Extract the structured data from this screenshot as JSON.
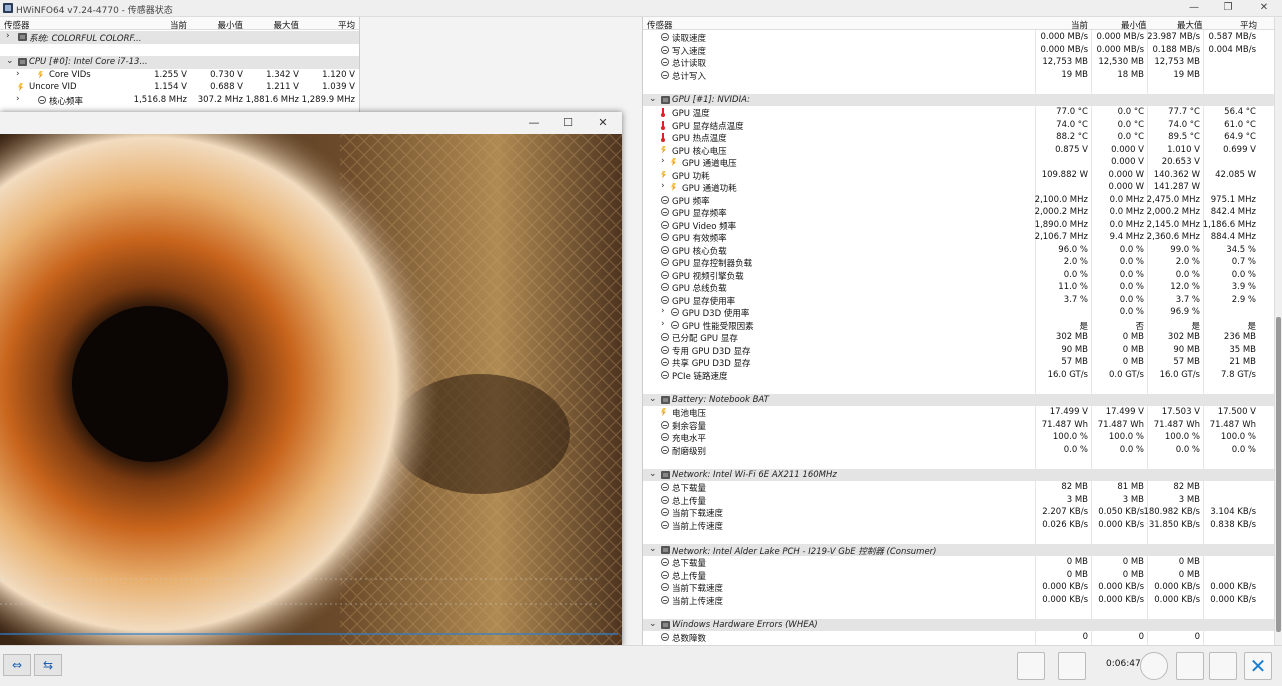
{
  "window": {
    "title": "HWiNFO64 v7.24-4770 - 传感器状态"
  },
  "columns": {
    "sensor": "传感器",
    "current": "当前",
    "min": "最小值",
    "max": "最大值",
    "avg": "平均"
  },
  "left_rows": [
    {
      "type": "group",
      "chev": "›",
      "label": "系统: COLORFUL COLORF...",
      "current": "",
      "min": "",
      "max": "",
      "avg": ""
    },
    {
      "type": "spacer"
    },
    {
      "type": "group",
      "chev": "⌄",
      "label": "CPU [#0]: Intel Core i7-13...",
      "current": "",
      "min": "",
      "max": "",
      "avg": ""
    },
    {
      "type": "item",
      "icon": "bolt",
      "chev": "›",
      "indent": 1,
      "label": "Core VIDs",
      "current": "1.255 V",
      "min": "0.730 V",
      "max": "1.342 V",
      "avg": "1.120 V"
    },
    {
      "type": "item",
      "icon": "bolt",
      "indent": 0,
      "label": "Uncore VID",
      "current": "1.154 V",
      "min": "0.688 V",
      "max": "1.211 V",
      "avg": "1.039 V"
    },
    {
      "type": "item",
      "icon": "clock",
      "chev": "›",
      "indent": 1,
      "label": "核心频率",
      "current": "1,516.8 MHz",
      "min": "307.2 MHz",
      "max": "1,881.6 MHz",
      "avg": "1,289.9 MHz"
    }
  ],
  "right_rows": [
    {
      "type": "item",
      "icon": "clock",
      "label": "读取速度",
      "current": "0.000 MB/s",
      "min": "0.000 MB/s",
      "max": "23.987 MB/s",
      "avg": "0.587 MB/s"
    },
    {
      "type": "item",
      "icon": "clock",
      "label": "写入速度",
      "current": "0.000 MB/s",
      "min": "0.000 MB/s",
      "max": "0.188 MB/s",
      "avg": "0.004 MB/s"
    },
    {
      "type": "item",
      "icon": "clock",
      "label": "总计读取",
      "current": "12,753 MB",
      "min": "12,530 MB",
      "max": "12,753 MB",
      "avg": ""
    },
    {
      "type": "item",
      "icon": "clock",
      "label": "总计写入",
      "current": "19 MB",
      "min": "18 MB",
      "max": "19 MB",
      "avg": ""
    },
    {
      "type": "spacer"
    },
    {
      "type": "group",
      "label": "GPU [#1]: NVIDIA:"
    },
    {
      "type": "item",
      "icon": "therm",
      "label": "GPU 温度",
      "current": "77.0 °C",
      "min": "0.0 °C",
      "max": "77.7 °C",
      "avg": "56.4 °C"
    },
    {
      "type": "item",
      "icon": "therm",
      "label": "GPU 显存结点温度",
      "current": "74.0 °C",
      "min": "0.0 °C",
      "max": "74.0 °C",
      "avg": "61.0 °C"
    },
    {
      "type": "item",
      "icon": "therm",
      "label": "GPU 热点温度",
      "current": "88.2 °C",
      "min": "0.0 °C",
      "max": "89.5 °C",
      "avg": "64.9 °C"
    },
    {
      "type": "item",
      "icon": "bolt",
      "label": "GPU 核心电压",
      "current": "0.875 V",
      "min": "0.000 V",
      "max": "1.010 V",
      "avg": "0.699 V"
    },
    {
      "type": "item",
      "icon": "bolt",
      "chev": "›",
      "label": "GPU 通道电压",
      "current": "",
      "min": "0.000 V",
      "max": "20.653 V",
      "avg": ""
    },
    {
      "type": "item",
      "icon": "bolt",
      "label": "GPU 功耗",
      "current": "109.882 W",
      "min": "0.000 W",
      "max": "140.362 W",
      "avg": "42.085 W"
    },
    {
      "type": "item",
      "icon": "bolt",
      "chev": "›",
      "label": "GPU 通道功耗",
      "current": "",
      "min": "0.000 W",
      "max": "141.287 W",
      "avg": ""
    },
    {
      "type": "item",
      "icon": "clock",
      "label": "GPU 频率",
      "current": "2,100.0 MHz",
      "min": "0.0 MHz",
      "max": "2,475.0 MHz",
      "avg": "975.1 MHz"
    },
    {
      "type": "item",
      "icon": "clock",
      "label": "GPU 显存频率",
      "current": "2,000.2 MHz",
      "min": "0.0 MHz",
      "max": "2,000.2 MHz",
      "avg": "842.4 MHz"
    },
    {
      "type": "item",
      "icon": "clock",
      "label": "GPU Video 频率",
      "current": "1,890.0 MHz",
      "min": "0.0 MHz",
      "max": "2,145.0 MHz",
      "avg": "1,186.6 MHz"
    },
    {
      "type": "item",
      "icon": "clock",
      "label": "GPU 有效频率",
      "current": "2,106.7 MHz",
      "min": "9.4 MHz",
      "max": "2,360.6 MHz",
      "avg": "884.4 MHz"
    },
    {
      "type": "item",
      "icon": "clock",
      "label": "GPU 核心负载",
      "current": "96.0 %",
      "min": "0.0 %",
      "max": "99.0 %",
      "avg": "34.5 %"
    },
    {
      "type": "item",
      "icon": "clock",
      "label": "GPU 显存控制器负载",
      "current": "2.0 %",
      "min": "0.0 %",
      "max": "2.0 %",
      "avg": "0.7 %"
    },
    {
      "type": "item",
      "icon": "clock",
      "label": "GPU 视频引擎负载",
      "current": "0.0 %",
      "min": "0.0 %",
      "max": "0.0 %",
      "avg": "0.0 %"
    },
    {
      "type": "item",
      "icon": "clock",
      "label": "GPU 总线负载",
      "current": "11.0 %",
      "min": "0.0 %",
      "max": "12.0 %",
      "avg": "3.9 %"
    },
    {
      "type": "item",
      "icon": "clock",
      "label": "GPU 显存使用率",
      "current": "3.7 %",
      "min": "0.0 %",
      "max": "3.7 %",
      "avg": "2.9 %"
    },
    {
      "type": "item",
      "icon": "clock",
      "chev": "›",
      "label": "GPU D3D 使用率",
      "current": "",
      "min": "0.0 %",
      "max": "96.9 %",
      "avg": ""
    },
    {
      "type": "item",
      "icon": "clock",
      "chev": "›",
      "label": "GPU 性能受限因素",
      "current": "是",
      "min": "否",
      "max": "是",
      "avg": "是"
    },
    {
      "type": "item",
      "icon": "clock",
      "label": "已分配 GPU 显存",
      "current": "302 MB",
      "min": "0 MB",
      "max": "302 MB",
      "avg": "236 MB"
    },
    {
      "type": "item",
      "icon": "clock",
      "label": "专用 GPU D3D 显存",
      "current": "90 MB",
      "min": "0 MB",
      "max": "90 MB",
      "avg": "35 MB"
    },
    {
      "type": "item",
      "icon": "clock",
      "label": "共享 GPU D3D 显存",
      "current": "57 MB",
      "min": "0 MB",
      "max": "57 MB",
      "avg": "21 MB"
    },
    {
      "type": "item",
      "icon": "clock",
      "label": "PCIe 链路速度",
      "current": "16.0 GT/s",
      "min": "0.0 GT/s",
      "max": "16.0 GT/s",
      "avg": "7.8 GT/s"
    },
    {
      "type": "spacer"
    },
    {
      "type": "group",
      "label": "Battery: Notebook BAT"
    },
    {
      "type": "item",
      "icon": "bolt",
      "label": "电池电压",
      "current": "17.499 V",
      "min": "17.499 V",
      "max": "17.503 V",
      "avg": "17.500 V"
    },
    {
      "type": "item",
      "icon": "clock",
      "label": "剩余容量",
      "current": "71.487 Wh",
      "min": "71.487 Wh",
      "max": "71.487 Wh",
      "avg": "71.487 Wh"
    },
    {
      "type": "item",
      "icon": "clock",
      "label": "充电水平",
      "current": "100.0 %",
      "min": "100.0 %",
      "max": "100.0 %",
      "avg": "100.0 %"
    },
    {
      "type": "item",
      "icon": "clock",
      "label": "耐磨级别",
      "current": "0.0 %",
      "min": "0.0 %",
      "max": "0.0 %",
      "avg": "0.0 %"
    },
    {
      "type": "spacer"
    },
    {
      "type": "group",
      "label": "Network: Intel Wi-Fi 6E AX211 160MHz"
    },
    {
      "type": "item",
      "icon": "clock",
      "label": "总下载量",
      "current": "82 MB",
      "min": "81 MB",
      "max": "82 MB",
      "avg": ""
    },
    {
      "type": "item",
      "icon": "clock",
      "label": "总上传量",
      "current": "3 MB",
      "min": "3 MB",
      "max": "3 MB",
      "avg": ""
    },
    {
      "type": "item",
      "icon": "clock",
      "label": "当前下载速度",
      "current": "2.207 KB/s",
      "min": "0.050 KB/s",
      "max": "180.982 KB/s",
      "avg": "3.104 KB/s"
    },
    {
      "type": "item",
      "icon": "clock",
      "label": "当前上传速度",
      "current": "0.026 KB/s",
      "min": "0.000 KB/s",
      "max": "31.850 KB/s",
      "avg": "0.838 KB/s"
    },
    {
      "type": "spacer"
    },
    {
      "type": "group",
      "label": "Network: Intel Alder Lake PCH - I219-V GbE 控制器 (Consumer)"
    },
    {
      "type": "item",
      "icon": "clock",
      "label": "总下载量",
      "current": "0 MB",
      "min": "0 MB",
      "max": "0 MB",
      "avg": ""
    },
    {
      "type": "item",
      "icon": "clock",
      "label": "总上传量",
      "current": "0 MB",
      "min": "0 MB",
      "max": "0 MB",
      "avg": ""
    },
    {
      "type": "item",
      "icon": "clock",
      "label": "当前下载速度",
      "current": "0.000 KB/s",
      "min": "0.000 KB/s",
      "max": "0.000 KB/s",
      "avg": "0.000 KB/s"
    },
    {
      "type": "item",
      "icon": "clock",
      "label": "当前上传速度",
      "current": "0.000 KB/s",
      "min": "0.000 KB/s",
      "max": "0.000 KB/s",
      "avg": "0.000 KB/s"
    },
    {
      "type": "spacer"
    },
    {
      "type": "group",
      "label": "Windows Hardware Errors (WHEA)"
    },
    {
      "type": "item",
      "icon": "clock",
      "label": "总数障数",
      "current": "0",
      "min": "0",
      "max": "0",
      "avg": ""
    }
  ],
  "status": {
    "time": "0:06:47"
  },
  "colors": {
    "group_bg": "#e4e4e4",
    "accent": "#1a5fb4"
  }
}
